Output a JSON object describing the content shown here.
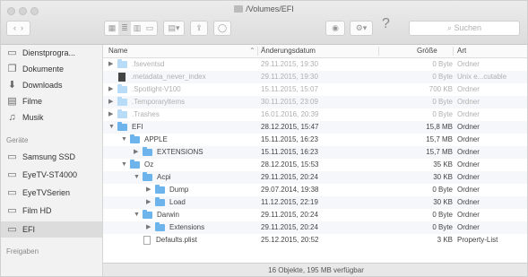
{
  "window": {
    "title": "/Volumes/EFI"
  },
  "toolbar": {
    "search_placeholder": "Suchen",
    "help_label": "?"
  },
  "sidebar": {
    "items": [
      {
        "label": "Dienstprogra...",
        "icon": "folder-icon"
      },
      {
        "label": "Dokumente",
        "icon": "documents-icon"
      },
      {
        "label": "Downloads",
        "icon": "download-icon"
      },
      {
        "label": "Filme",
        "icon": "film-icon"
      },
      {
        "label": "Musik",
        "icon": "music-icon"
      }
    ],
    "devices_header": "Geräte",
    "devices": [
      {
        "label": "Samsung SSD",
        "icon": "drive-icon"
      },
      {
        "label": "EyeTV-ST4000",
        "icon": "drive-icon"
      },
      {
        "label": "EyeTVSerien",
        "icon": "drive-icon"
      },
      {
        "label": "Film HD",
        "icon": "drive-icon"
      },
      {
        "label": "EFI",
        "icon": "drive-icon",
        "selected": true
      }
    ],
    "shares_header": "Freigaben"
  },
  "columns": {
    "name": "Name",
    "modified": "Änderungsdatum",
    "size": "Größe",
    "kind": "Art"
  },
  "rows": [
    {
      "name": ".fseventsd",
      "date": "29.11.2015, 19:30",
      "size": "0 Byte",
      "kind": "Ordner"
    },
    {
      "name": ".metadata_never_index",
      "date": "29.11.2015, 19:30",
      "size": "0 Byte",
      "kind": "Unix e...cutable"
    },
    {
      "name": ".Spotlight-V100",
      "date": "15.11.2015, 15:07",
      "size": "700 KB",
      "kind": "Ordner"
    },
    {
      "name": ".Temporaryltems",
      "date": "30.11.2015, 23:09",
      "size": "0 Byte",
      "kind": "Ordner"
    },
    {
      "name": ".Trashes",
      "date": "16.01.2016, 20:39",
      "size": "0 Byte",
      "kind": "Ordner"
    },
    {
      "name": "EFI",
      "date": "28.12.2015, 15:47",
      "size": "15,8 MB",
      "kind": "Ordner"
    },
    {
      "name": "APPLE",
      "date": "15.11.2015, 16:23",
      "size": "15,7 MB",
      "kind": "Ordner"
    },
    {
      "name": "EXTENSIONS",
      "date": "15.11.2015, 16:23",
      "size": "15,7 MB",
      "kind": "Ordner"
    },
    {
      "name": "Oz",
      "date": "28.12.2015, 15:53",
      "size": "35 KB",
      "kind": "Ordner"
    },
    {
      "name": "Acpi",
      "date": "29.11.2015, 20:24",
      "size": "30 KB",
      "kind": "Ordner"
    },
    {
      "name": "Dump",
      "date": "29.07.2014, 19:38",
      "size": "0 Byte",
      "kind": "Ordner"
    },
    {
      "name": "Load",
      "date": "11.12.2015, 22:19",
      "size": "30 KB",
      "kind": "Ordner"
    },
    {
      "name": "Darwin",
      "date": "29.11.2015, 20:24",
      "size": "0 Byte",
      "kind": "Ordner"
    },
    {
      "name": "Extensions",
      "date": "29.11.2015, 20:24",
      "size": "0 Byte",
      "kind": "Ordner"
    },
    {
      "name": "Defaults.plist",
      "date": "25.12.2015, 20:52",
      "size": "3 KB",
      "kind": "Property-List"
    }
  ],
  "status": {
    "text": "16 Objekte, 195 MB verfügbar"
  },
  "colors": {
    "folder": "#6db4ec",
    "selection": "#dcdcdc"
  }
}
